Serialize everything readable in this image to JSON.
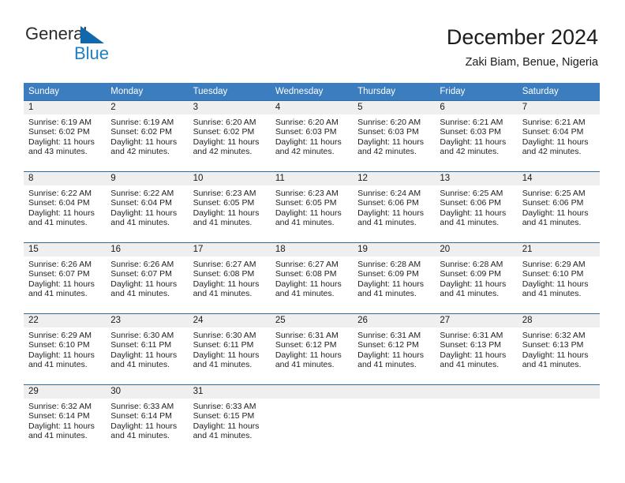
{
  "brand": {
    "name_part1": "General",
    "name_part2": "Blue",
    "flag_icon": "triangle-flag-icon",
    "accent_color": "#1f7fc4"
  },
  "header": {
    "title": "December 2024",
    "subtitle": "Zaki Biam, Benue, Nigeria"
  },
  "theme": {
    "header_row_bg": "#3b7dbf",
    "cell_band_bg": "#efefef",
    "row_divider": "#2e6da4",
    "text_color": "#1a1a1a"
  },
  "weekdays": [
    "Sunday",
    "Monday",
    "Tuesday",
    "Wednesday",
    "Thursday",
    "Friday",
    "Saturday"
  ],
  "weeks": [
    [
      {
        "day": "1",
        "sunrise": "Sunrise: 6:19 AM",
        "sunset": "Sunset: 6:02 PM",
        "daylight": "Daylight: 11 hours and 43 minutes."
      },
      {
        "day": "2",
        "sunrise": "Sunrise: 6:19 AM",
        "sunset": "Sunset: 6:02 PM",
        "daylight": "Daylight: 11 hours and 42 minutes."
      },
      {
        "day": "3",
        "sunrise": "Sunrise: 6:20 AM",
        "sunset": "Sunset: 6:02 PM",
        "daylight": "Daylight: 11 hours and 42 minutes."
      },
      {
        "day": "4",
        "sunrise": "Sunrise: 6:20 AM",
        "sunset": "Sunset: 6:03 PM",
        "daylight": "Daylight: 11 hours and 42 minutes."
      },
      {
        "day": "5",
        "sunrise": "Sunrise: 6:20 AM",
        "sunset": "Sunset: 6:03 PM",
        "daylight": "Daylight: 11 hours and 42 minutes."
      },
      {
        "day": "6",
        "sunrise": "Sunrise: 6:21 AM",
        "sunset": "Sunset: 6:03 PM",
        "daylight": "Daylight: 11 hours and 42 minutes."
      },
      {
        "day": "7",
        "sunrise": "Sunrise: 6:21 AM",
        "sunset": "Sunset: 6:04 PM",
        "daylight": "Daylight: 11 hours and 42 minutes."
      }
    ],
    [
      {
        "day": "8",
        "sunrise": "Sunrise: 6:22 AM",
        "sunset": "Sunset: 6:04 PM",
        "daylight": "Daylight: 11 hours and 41 minutes."
      },
      {
        "day": "9",
        "sunrise": "Sunrise: 6:22 AM",
        "sunset": "Sunset: 6:04 PM",
        "daylight": "Daylight: 11 hours and 41 minutes."
      },
      {
        "day": "10",
        "sunrise": "Sunrise: 6:23 AM",
        "sunset": "Sunset: 6:05 PM",
        "daylight": "Daylight: 11 hours and 41 minutes."
      },
      {
        "day": "11",
        "sunrise": "Sunrise: 6:23 AM",
        "sunset": "Sunset: 6:05 PM",
        "daylight": "Daylight: 11 hours and 41 minutes."
      },
      {
        "day": "12",
        "sunrise": "Sunrise: 6:24 AM",
        "sunset": "Sunset: 6:06 PM",
        "daylight": "Daylight: 11 hours and 41 minutes."
      },
      {
        "day": "13",
        "sunrise": "Sunrise: 6:25 AM",
        "sunset": "Sunset: 6:06 PM",
        "daylight": "Daylight: 11 hours and 41 minutes."
      },
      {
        "day": "14",
        "sunrise": "Sunrise: 6:25 AM",
        "sunset": "Sunset: 6:06 PM",
        "daylight": "Daylight: 11 hours and 41 minutes."
      }
    ],
    [
      {
        "day": "15",
        "sunrise": "Sunrise: 6:26 AM",
        "sunset": "Sunset: 6:07 PM",
        "daylight": "Daylight: 11 hours and 41 minutes."
      },
      {
        "day": "16",
        "sunrise": "Sunrise: 6:26 AM",
        "sunset": "Sunset: 6:07 PM",
        "daylight": "Daylight: 11 hours and 41 minutes."
      },
      {
        "day": "17",
        "sunrise": "Sunrise: 6:27 AM",
        "sunset": "Sunset: 6:08 PM",
        "daylight": "Daylight: 11 hours and 41 minutes."
      },
      {
        "day": "18",
        "sunrise": "Sunrise: 6:27 AM",
        "sunset": "Sunset: 6:08 PM",
        "daylight": "Daylight: 11 hours and 41 minutes."
      },
      {
        "day": "19",
        "sunrise": "Sunrise: 6:28 AM",
        "sunset": "Sunset: 6:09 PM",
        "daylight": "Daylight: 11 hours and 41 minutes."
      },
      {
        "day": "20",
        "sunrise": "Sunrise: 6:28 AM",
        "sunset": "Sunset: 6:09 PM",
        "daylight": "Daylight: 11 hours and 41 minutes."
      },
      {
        "day": "21",
        "sunrise": "Sunrise: 6:29 AM",
        "sunset": "Sunset: 6:10 PM",
        "daylight": "Daylight: 11 hours and 41 minutes."
      }
    ],
    [
      {
        "day": "22",
        "sunrise": "Sunrise: 6:29 AM",
        "sunset": "Sunset: 6:10 PM",
        "daylight": "Daylight: 11 hours and 41 minutes."
      },
      {
        "day": "23",
        "sunrise": "Sunrise: 6:30 AM",
        "sunset": "Sunset: 6:11 PM",
        "daylight": "Daylight: 11 hours and 41 minutes."
      },
      {
        "day": "24",
        "sunrise": "Sunrise: 6:30 AM",
        "sunset": "Sunset: 6:11 PM",
        "daylight": "Daylight: 11 hours and 41 minutes."
      },
      {
        "day": "25",
        "sunrise": "Sunrise: 6:31 AM",
        "sunset": "Sunset: 6:12 PM",
        "daylight": "Daylight: 11 hours and 41 minutes."
      },
      {
        "day": "26",
        "sunrise": "Sunrise: 6:31 AM",
        "sunset": "Sunset: 6:12 PM",
        "daylight": "Daylight: 11 hours and 41 minutes."
      },
      {
        "day": "27",
        "sunrise": "Sunrise: 6:31 AM",
        "sunset": "Sunset: 6:13 PM",
        "daylight": "Daylight: 11 hours and 41 minutes."
      },
      {
        "day": "28",
        "sunrise": "Sunrise: 6:32 AM",
        "sunset": "Sunset: 6:13 PM",
        "daylight": "Daylight: 11 hours and 41 minutes."
      }
    ],
    [
      {
        "day": "29",
        "sunrise": "Sunrise: 6:32 AM",
        "sunset": "Sunset: 6:14 PM",
        "daylight": "Daylight: 11 hours and 41 minutes."
      },
      {
        "day": "30",
        "sunrise": "Sunrise: 6:33 AM",
        "sunset": "Sunset: 6:14 PM",
        "daylight": "Daylight: 11 hours and 41 minutes."
      },
      {
        "day": "31",
        "sunrise": "Sunrise: 6:33 AM",
        "sunset": "Sunset: 6:15 PM",
        "daylight": "Daylight: 11 hours and 41 minutes."
      },
      {
        "day": "",
        "sunrise": "",
        "sunset": "",
        "daylight": ""
      },
      {
        "day": "",
        "sunrise": "",
        "sunset": "",
        "daylight": ""
      },
      {
        "day": "",
        "sunrise": "",
        "sunset": "",
        "daylight": ""
      },
      {
        "day": "",
        "sunrise": "",
        "sunset": "",
        "daylight": ""
      }
    ]
  ]
}
